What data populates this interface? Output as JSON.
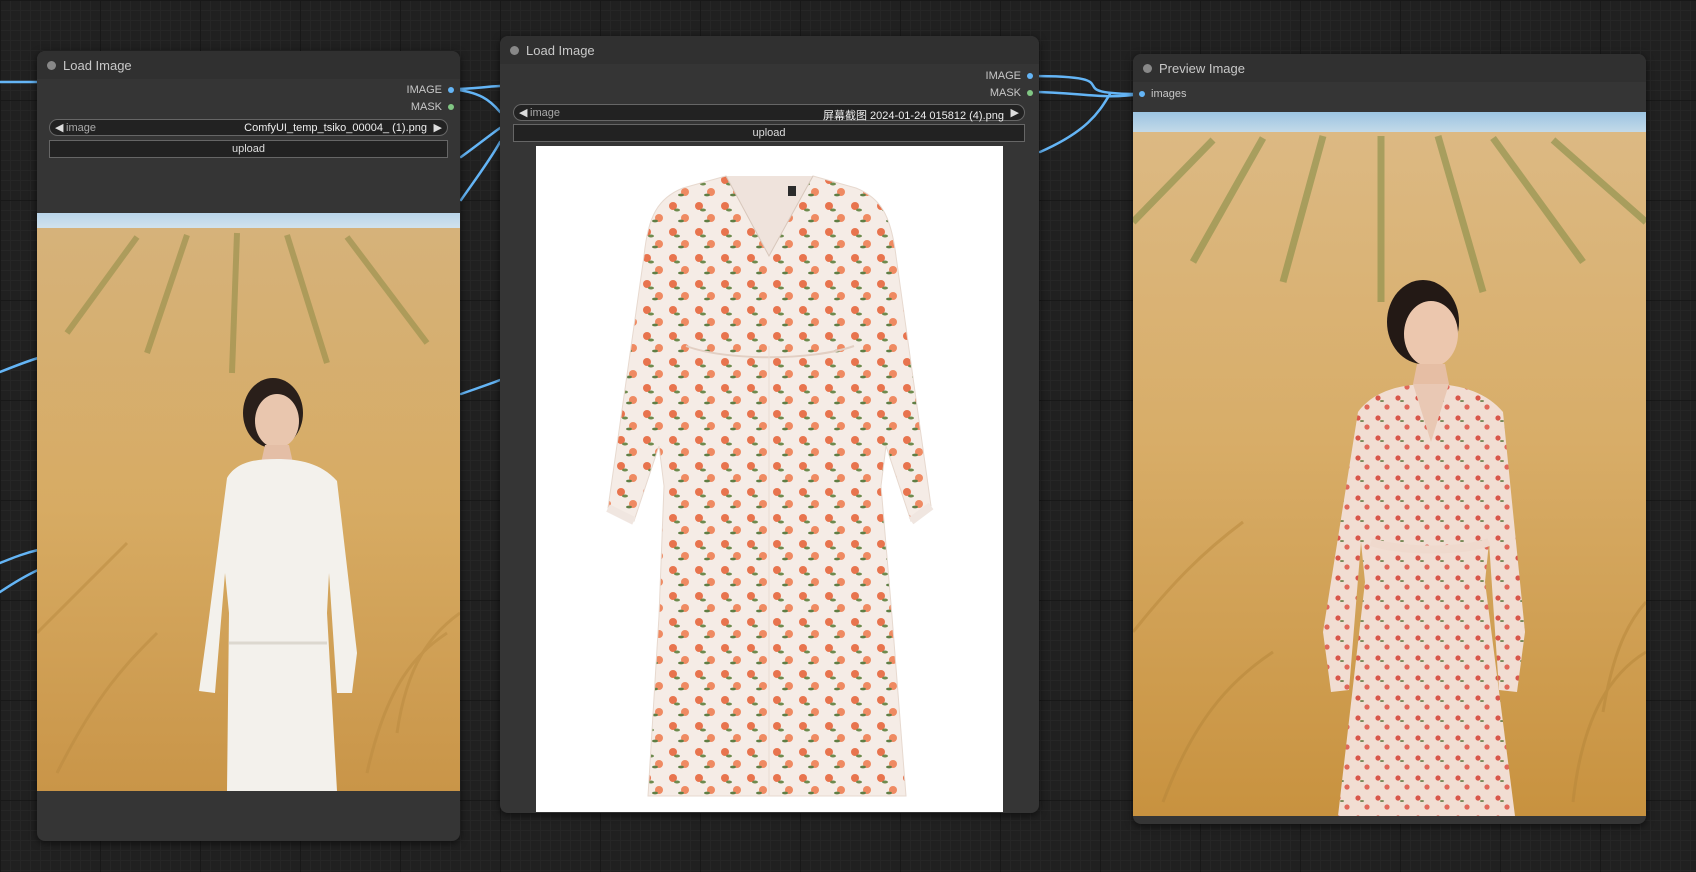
{
  "nodes": {
    "load1": {
      "title": "Load Image",
      "outputs": {
        "image": "IMAGE",
        "mask": "MASK"
      },
      "widget": {
        "name": "image",
        "value": "ComfyUI_temp_tsiko_00004_ (1).png"
      },
      "upload_label": "upload",
      "preview": "woman in white dress standing in wheat field"
    },
    "load2": {
      "title": "Load Image",
      "outputs": {
        "image": "IMAGE",
        "mask": "MASK"
      },
      "widget": {
        "name": "image",
        "value": "屏幕截图 2024-01-24 015812 (4).png"
      },
      "upload_label": "upload",
      "preview": "long-sleeve floral print dress on white background"
    },
    "preview": {
      "title": "Preview Image",
      "inputs": {
        "images": "images"
      },
      "preview": "woman in floral dress standing in wheat field"
    }
  },
  "colors": {
    "canvas": "#202020",
    "node_body": "#353535",
    "link_image": "#64b5f6",
    "slot_mask": "#81c784",
    "wheat": "#d8b372",
    "sky": "#a8cbe6"
  }
}
